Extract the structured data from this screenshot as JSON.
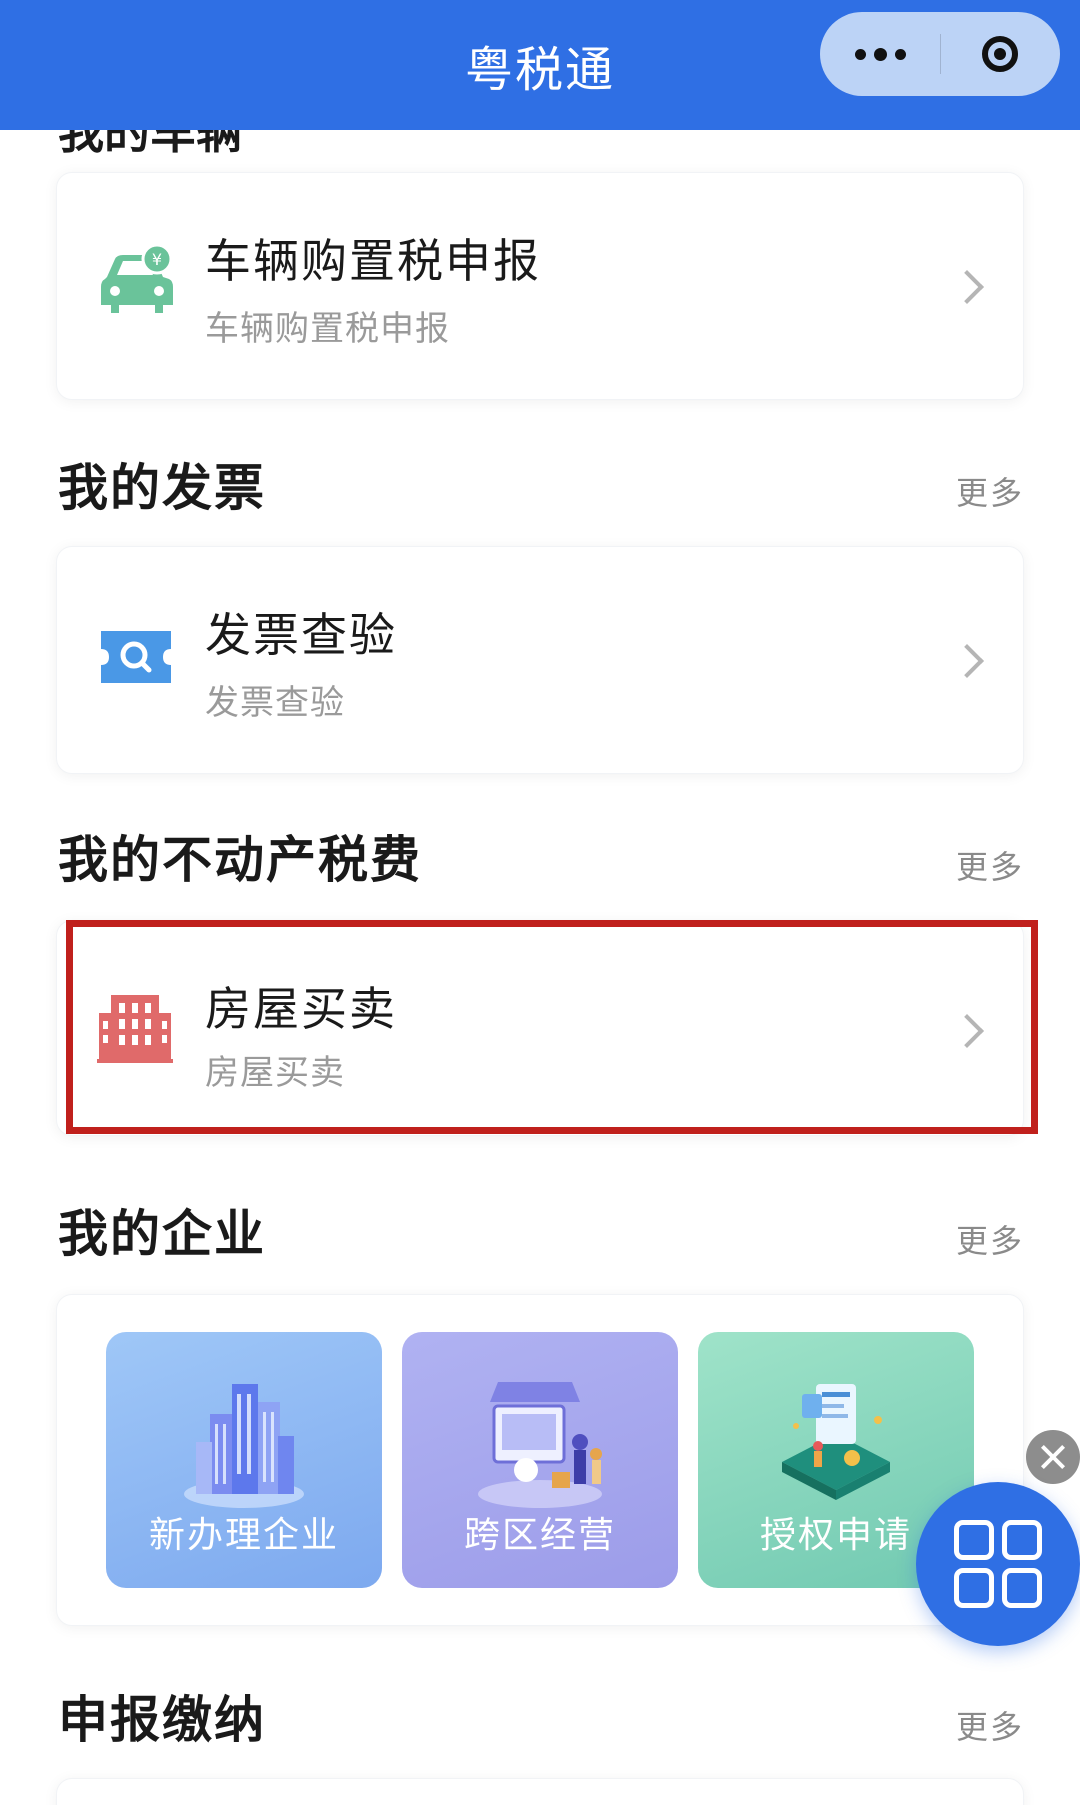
{
  "header": {
    "title": "粤税通"
  },
  "capsule": {
    "more_icon": "more-dots-icon",
    "close_icon": "close-circle-icon"
  },
  "partial_section": {
    "title": "我的车辆"
  },
  "vehicle_card": {
    "title": "车辆购置税申报",
    "subtitle": "车辆购置税申报",
    "icon": "car-tax-icon",
    "icon_color": "#6ac39a"
  },
  "invoice_section": {
    "title": "我的发票",
    "more": "更多"
  },
  "invoice_card": {
    "title": "发票查验",
    "subtitle": "发票查验",
    "icon": "invoice-search-icon",
    "icon_color": "#4a98e6"
  },
  "property_section": {
    "title": "我的不动产税费",
    "more": "更多"
  },
  "property_card": {
    "title": "房屋买卖",
    "subtitle": "房屋买卖",
    "icon": "building-icon",
    "icon_color": "#e06a6a",
    "highlight_color": "#c0201c"
  },
  "enterprise_section": {
    "title": "我的企业",
    "more": "更多",
    "tiles": [
      {
        "label": "新办理企业",
        "icon": "city-buildings-icon"
      },
      {
        "label": "跨区经营",
        "icon": "business-store-icon"
      },
      {
        "label": "授权申请",
        "icon": "authorization-document-icon"
      }
    ]
  },
  "declaration_section": {
    "title": "申报缴纳",
    "more": "更多"
  },
  "floating": {
    "close_icon": "close-icon",
    "menu_icon": "grid-menu-icon",
    "accent": "#2f6fe4"
  }
}
